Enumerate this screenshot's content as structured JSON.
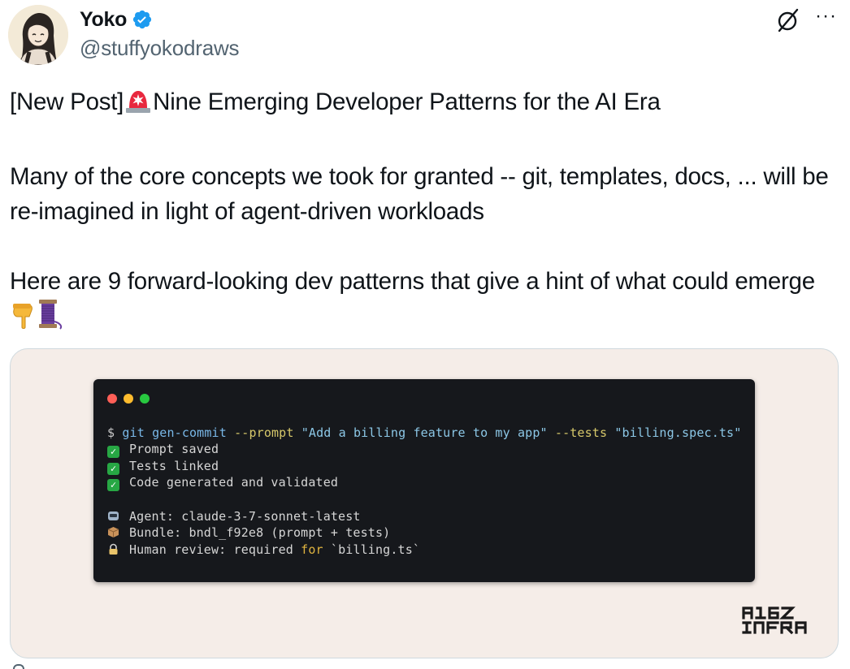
{
  "author": {
    "display_name": "Yoko",
    "handle": "@stuffyokodraws",
    "verified": true
  },
  "icons": {
    "verified": "verified-badge-icon",
    "grok": "grok-icon",
    "more": "more-options-icon"
  },
  "body": {
    "line1_a": "[New Post]",
    "line1_b": "Nine Emerging Developer Patterns for the AI Era",
    "para2": "Many of the core concepts we took for granted -- git, templates, docs, ... will be re-imagined in light of agent-driven workloads",
    "para3_a": "Here are 9 forward-looking dev patterns that give a hint of what could emerge",
    "emojis": [
      "rotating-light",
      "pointing-down",
      "thread-spool"
    ]
  },
  "terminal": {
    "cmd_prompt": "$ ",
    "cmd_git": "git gen-commit ",
    "cmd_flag1": "--prompt ",
    "cmd_str1": "\"Add a billing feature to my app\" ",
    "cmd_flag2": "--tests ",
    "cmd_str2": "\"billing.spec.ts\"",
    "check1": "Prompt saved",
    "check2": "Tests linked",
    "check3": "Code generated and validated",
    "agent": "Agent: claude-3-7-sonnet-latest",
    "bundle": "Bundle: bndl_f92e8 (prompt + tests)",
    "review_a": "Human review: required ",
    "review_kw": "for",
    "review_b": " `billing.ts`"
  },
  "logo_text": "A16Z INFRA",
  "colors": {
    "verified_blue": "#1d9bf0",
    "handle_gray": "#536471",
    "card_bg": "#f5ede8",
    "terminal_bg": "#16181c",
    "dot_red": "#ff5f57",
    "dot_yellow": "#febc2e",
    "dot_green": "#28c840",
    "check_green": "#27a744"
  }
}
